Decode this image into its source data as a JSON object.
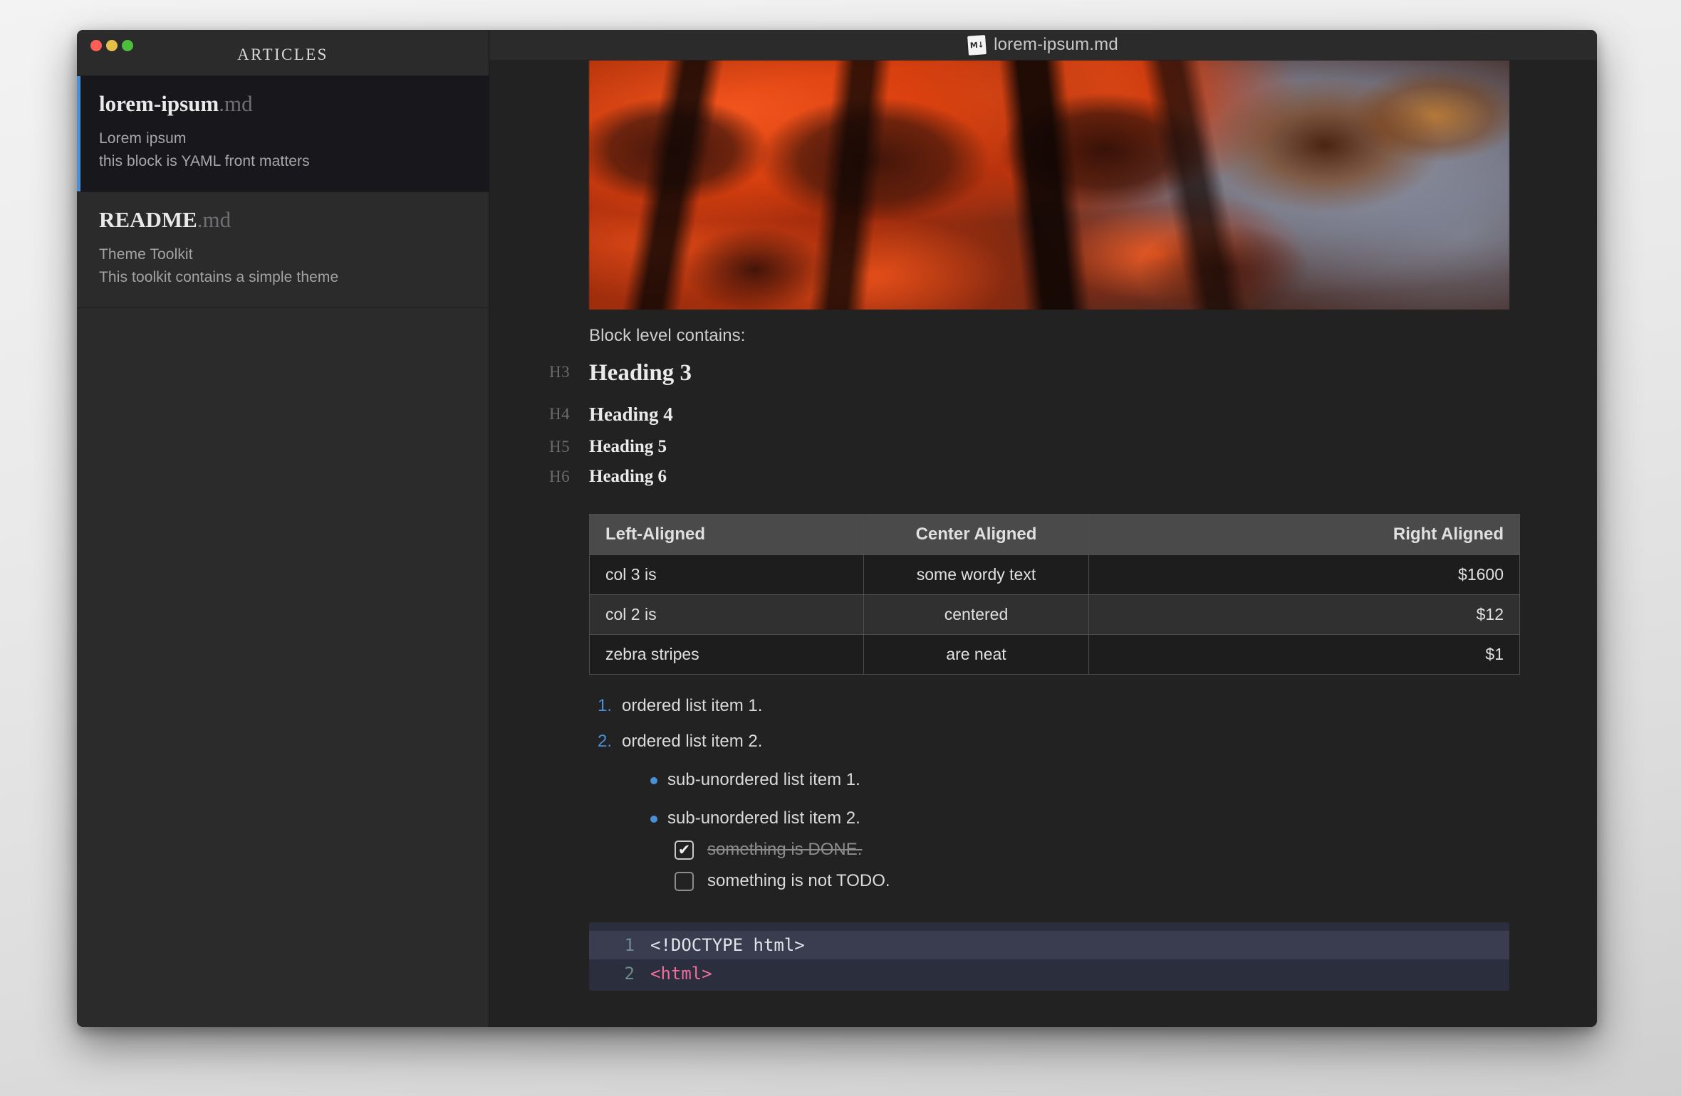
{
  "window": {
    "traffic_lights": [
      {
        "name": "close",
        "color": "#ff5f56"
      },
      {
        "name": "minimize",
        "color": "#e4c04a"
      },
      {
        "name": "maximize",
        "color": "#4dbf3e"
      }
    ]
  },
  "sidebar": {
    "header_title": "ARTICLES",
    "accent_color": "#4a90d9",
    "items": [
      {
        "name": "lorem-ipsum",
        "extension": ".md",
        "line1": "Lorem ipsum",
        "line2": "this block is YAML front matters",
        "selected": true
      },
      {
        "name": "README",
        "extension": ".md",
        "line1": "Theme Toolkit",
        "line2": "This toolkit contains a simple theme",
        "selected": false
      }
    ]
  },
  "titlebar": {
    "icon_glyph": "M↓",
    "icon_name": "markdown-file-icon",
    "filename": "lorem-ipsum.md"
  },
  "document": {
    "hero_image_alt": "blurred autumn maple leaves against a grey-blue sky",
    "intro_paragraph": "Block level contains:",
    "headings": [
      {
        "tag": "H3",
        "text": "Heading 3"
      },
      {
        "tag": "H4",
        "text": "Heading 4"
      },
      {
        "tag": "H5",
        "text": "Heading 5"
      },
      {
        "tag": "H6",
        "text": "Heading 6"
      }
    ],
    "table": {
      "headers": [
        "Left-Aligned",
        "Center Aligned",
        "Right Aligned"
      ],
      "rows": [
        [
          "col 3 is",
          "some wordy text",
          "$1600"
        ],
        [
          "col 2 is",
          "centered",
          "$12"
        ],
        [
          "zebra stripes",
          "are neat",
          "$1"
        ]
      ]
    },
    "ordered_list": [
      {
        "marker": "1.",
        "text": "ordered list item 1."
      },
      {
        "marker": "2.",
        "text": "ordered list item 2."
      }
    ],
    "unordered_list": [
      "sub-unordered list item 1.",
      "sub-unordered list item 2."
    ],
    "tasks": [
      {
        "checked": true,
        "check_glyph": "✔",
        "text": "something is DONE."
      },
      {
        "checked": false,
        "check_glyph": "",
        "text": "something is not TODO."
      }
    ],
    "code_block": {
      "language": "html",
      "lines": [
        {
          "number": "1",
          "text": "<!DOCTYPE html>",
          "highlighted": true,
          "style": "plain"
        },
        {
          "number": "2",
          "text": "<html>",
          "highlighted": false,
          "style": "tag"
        }
      ]
    }
  }
}
